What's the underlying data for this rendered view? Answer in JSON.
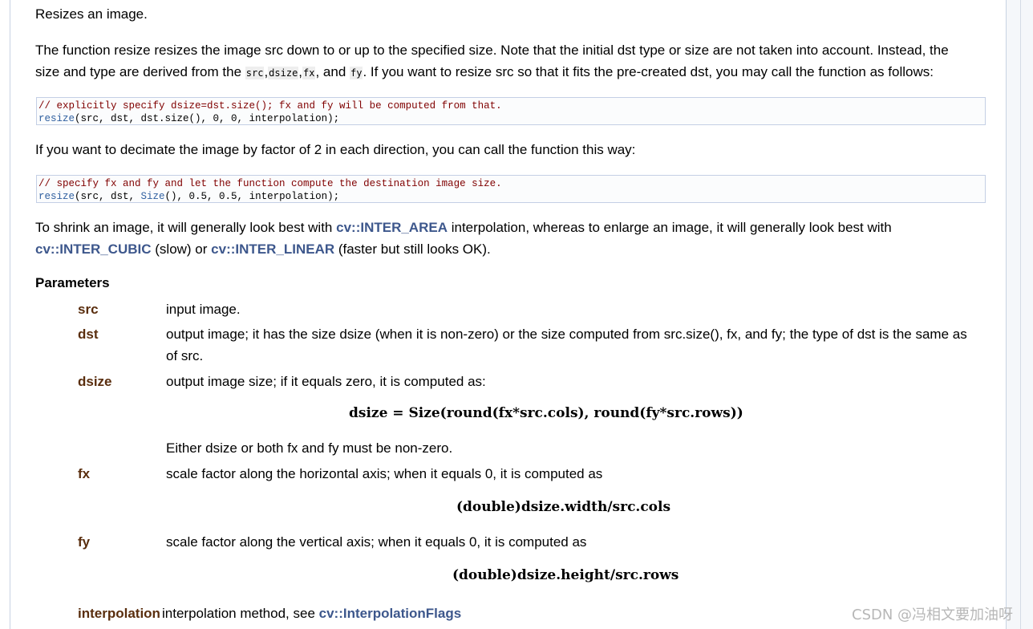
{
  "intro": "Resizes an image.",
  "para1": {
    "line1": "The function resize resizes the image src down to or up to the specified size. Note that the initial dst type or size are not taken into account. Instead, the",
    "line2_a": "size and type are derived from the ",
    "code_src": "src",
    "comma1": ",",
    "code_dsize": "dsize",
    "comma2": ",",
    "code_fx": "fx",
    "and_text": ", and ",
    "code_fy": "fy",
    "line2_b": ". If you want to resize src so that it fits the pre-created dst, you may call the function as follows:"
  },
  "code1": {
    "comment": "// explicitly specify dsize=dst.size(); fx and fy will be computed from that.",
    "func": "resize",
    "rest": "(src, dst, dst.size(), 0, 0, interpolation);"
  },
  "para2": "If you want to decimate the image by factor of 2 in each direction, you can call the function this way:",
  "code2": {
    "comment": "// specify fx and fy and let the function compute the destination image size.",
    "func": "resize",
    "mid1": "(src, dst, ",
    "func2": "Size",
    "rest": "(), 0.5, 0.5, interpolation);"
  },
  "para3": {
    "a": "To shrink an image, it will generally look best with ",
    "link1": "cv::INTER_AREA",
    "b": " interpolation, whereas to enlarge an image, it will generally look best with",
    "link2": "cv::INTER_CUBIC",
    "c": " (slow) or ",
    "link3": "cv::INTER_LINEAR",
    "d": " (faster but still looks OK)."
  },
  "params_title": "Parameters",
  "params": {
    "src": {
      "name": "src",
      "desc": "input image."
    },
    "dst": {
      "name": "dst",
      "desc1": "output image; it has the size dsize (when it is non-zero) or the size computed from src.size(), fx, and fy; the type of dst is the same as",
      "desc2": "of src."
    },
    "dsize": {
      "name": "dsize",
      "desc": "output image size; if it equals zero, it is computed as:",
      "formula": "dsize = Size(round(fx*src.cols), round(fy*src.rows))",
      "note": "Either dsize or both fx and fy must be non-zero."
    },
    "fx": {
      "name": "fx",
      "desc": "scale factor along the horizontal axis; when it equals 0, it is computed as",
      "formula": "(double)dsize.width/src.cols"
    },
    "fy": {
      "name": "fy",
      "desc": "scale factor along the vertical axis; when it equals 0, it is computed as",
      "formula": "(double)dsize.height/src.rows"
    },
    "interpolation": {
      "name": "interpolation",
      "desc": " interpolation method, see ",
      "link": "cv::InterpolationFlags"
    }
  },
  "watermark": "CSDN @冯相文要加油呀",
  "colors": {
    "link": "#3d578c",
    "param_name": "#5a2e0e",
    "comment": "#800000",
    "code_func": "#3060a0",
    "code_border": "#c4cfe5"
  }
}
